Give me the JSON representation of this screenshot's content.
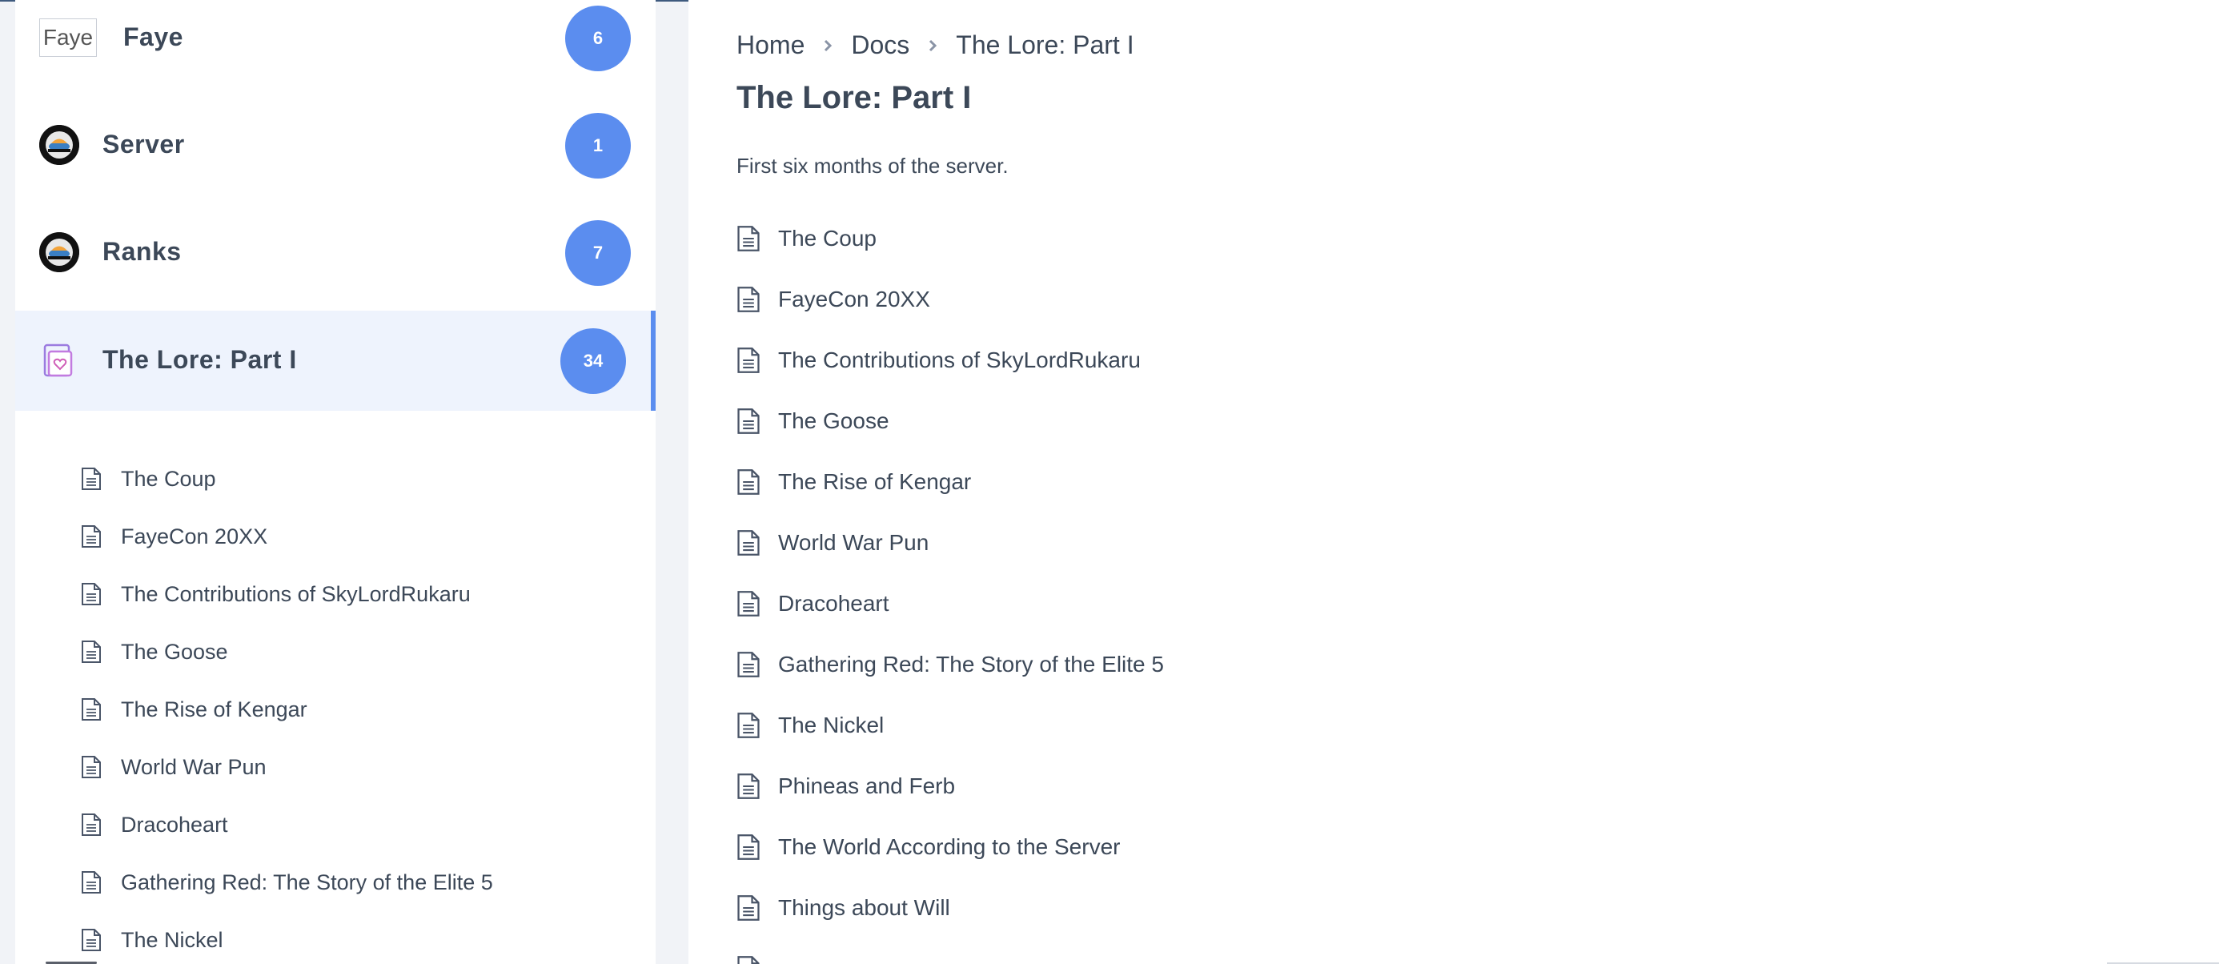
{
  "colors": {
    "accent": "#5b8def",
    "text": "#3c4858",
    "active_bg": "#eef3fd",
    "page_bg": "#f1f3f7"
  },
  "sidebar": {
    "categories": [
      {
        "logo_text": "Faye",
        "label": "Faye",
        "count": "6",
        "icon": "faye-logo-icon"
      },
      {
        "label": "Server",
        "count": "1",
        "icon": "server-logo-icon"
      },
      {
        "label": "Ranks",
        "count": "7",
        "icon": "ranks-logo-icon"
      },
      {
        "label": "The Lore: Part I",
        "count": "34",
        "icon": "folder-heart-icon",
        "active": true
      }
    ],
    "docs": [
      "The Coup",
      "FayeCon 20XX",
      "The Contributions of SkyLordRukaru",
      "The Goose",
      "The Rise of Kengar",
      "World War Pun",
      "Dracoheart",
      "Gathering Red: The Story of the Elite 5",
      "The Nickel"
    ]
  },
  "breadcrumb": [
    "Home",
    "Docs",
    "The Lore: Part I"
  ],
  "page": {
    "title": "The Lore: Part I",
    "description": "First six months of the server.",
    "docs": [
      "The Coup",
      "FayeCon 20XX",
      "The Contributions of SkyLordRukaru",
      "The Goose",
      "The Rise of Kengar",
      "World War Pun",
      "Dracoheart",
      "Gathering Red: The Story of the Elite 5",
      "The Nickel",
      "Phineas and Ferb",
      "The World According to the Server",
      "Things about Will"
    ]
  }
}
